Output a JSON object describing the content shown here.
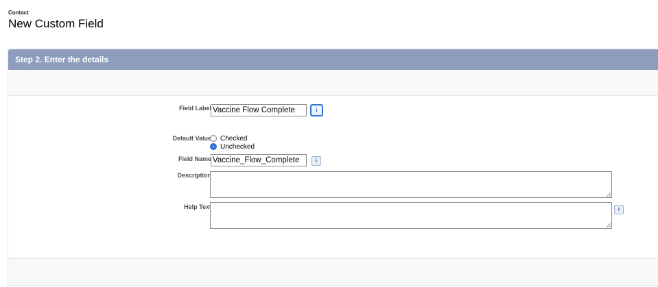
{
  "header": {
    "object_type": "Contact",
    "title": "New Custom Field"
  },
  "step": {
    "title": "Step 2. Enter the details"
  },
  "form": {
    "field_label": {
      "label": "Field Label",
      "value": "Vaccine Flow Complete"
    },
    "default_value": {
      "label": "Default Value",
      "options": [
        "Checked",
        "Unchecked"
      ],
      "selected": "Unchecked"
    },
    "field_name": {
      "label": "Field Name",
      "value": "Vaccine_Flow_Complete"
    },
    "description": {
      "label": "Description",
      "value": ""
    },
    "help_text": {
      "label": "Help Text",
      "value": ""
    }
  },
  "icons": {
    "info": "i"
  },
  "colors": {
    "header_bar": "#8e9dbe",
    "required": "#c00000",
    "radio_selected": "#2d6fd6"
  }
}
